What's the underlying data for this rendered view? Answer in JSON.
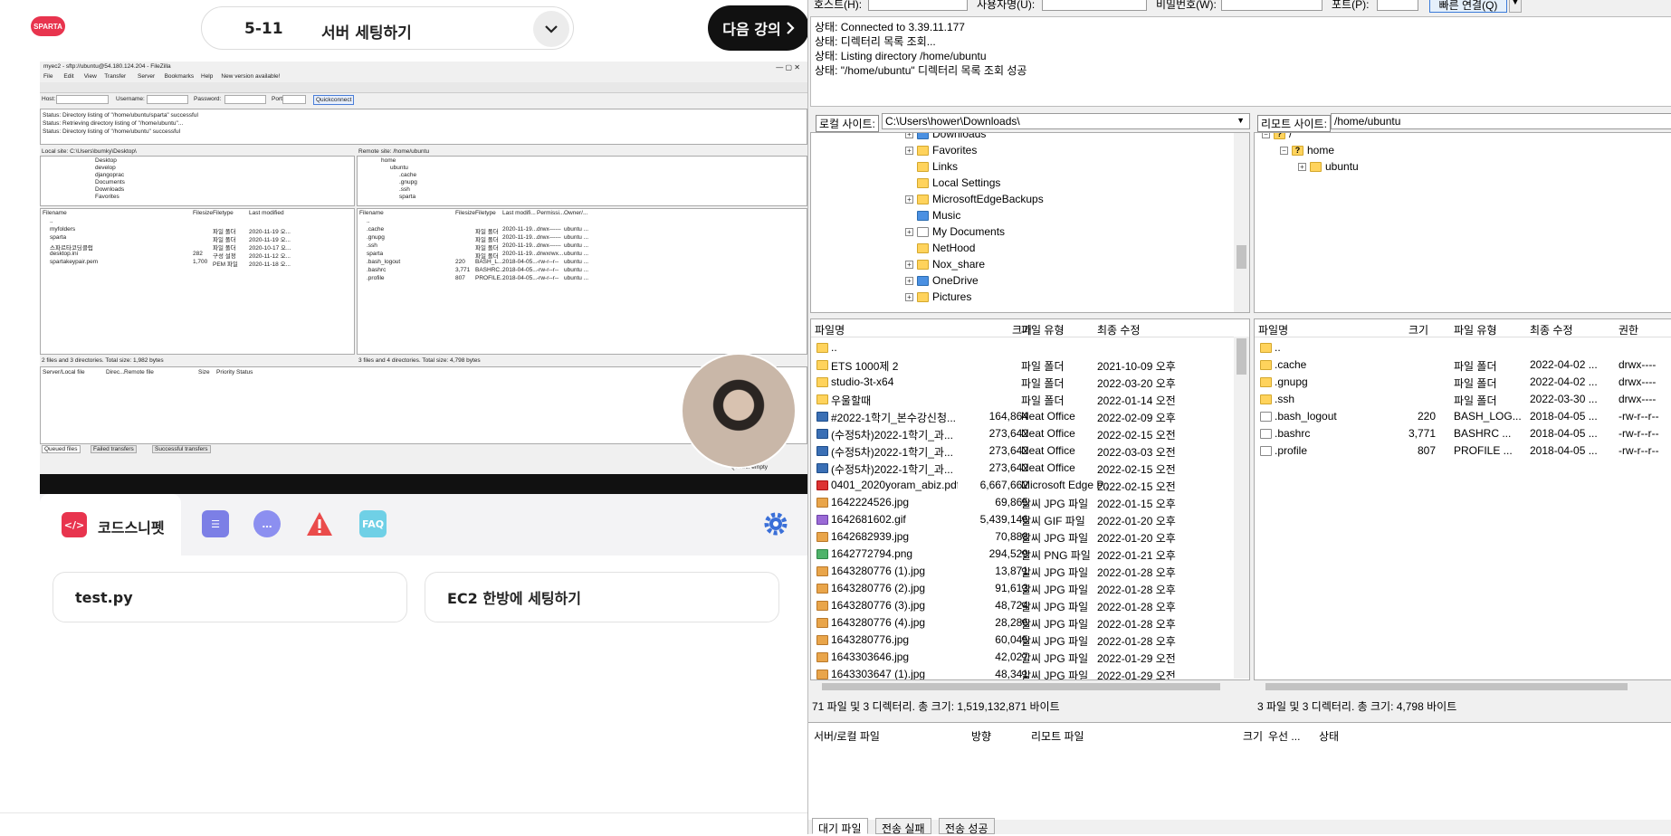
{
  "course": {
    "logo_text": "SPARTA",
    "lecture_number": "5-11",
    "lecture_title": "서버 세팅하기",
    "next_label": "다음 강의",
    "toolbar": {
      "snippet_label": "코드스니펫",
      "faq_label": "FAQ"
    },
    "cards": [
      "test.py",
      "EC2 한방에 세팅하기"
    ]
  },
  "video_filezilla": {
    "title": "myec2 - sftp://ubuntu@54.180.124.204 - FileZilla",
    "menu": [
      "File",
      "Edit",
      "View",
      "Transfer",
      "Server",
      "Bookmarks",
      "Help",
      "New version available!"
    ],
    "quick": {
      "host": "Host:",
      "username": "Username:",
      "password": "Password:",
      "port": "Port:",
      "button": "Quickconnect"
    },
    "log": [
      "Status:    Directory listing of \"/home/ubuntu/sparta\" successful",
      "Status:    Retrieving directory listing of \"/home/ubuntu\"...",
      "Status:    Directory listing of \"/home/ubuntu\" successful"
    ],
    "local_site_label": "Local site:",
    "local_site_path": "C:\\Users\\bumky\\Desktop\\",
    "remote_site_label": "Remote site:",
    "remote_site_path": "/home/ubuntu",
    "local_tree": [
      "Desktop",
      "develop",
      "djangoprac",
      "Documents",
      "Downloads",
      "Favorites"
    ],
    "remote_tree": [
      "home",
      "ubuntu",
      ".cache",
      ".gnupg",
      ".ssh",
      "sparta"
    ],
    "local_headers": [
      "Filename",
      "Filesize",
      "Filetype",
      "Last modified"
    ],
    "local_files": [
      {
        "name": "..",
        "size": "",
        "type": "",
        "date": ""
      },
      {
        "name": "myfolders",
        "size": "",
        "type": "파일 폴더",
        "date": "2020-11-19 오..."
      },
      {
        "name": "sparta",
        "size": "",
        "type": "파일 폴더",
        "date": "2020-11-19 오..."
      },
      {
        "name": "스파르타코딩클럽",
        "size": "",
        "type": "파일 폴더",
        "date": "2020-10-17 오..."
      },
      {
        "name": "desktop.ini",
        "size": "282",
        "type": "구성 설정",
        "date": "2020-11-12 오..."
      },
      {
        "name": "spartakeypair.pem",
        "size": "1,700",
        "type": "PEM 파일",
        "date": "2020-11-18 오..."
      }
    ],
    "remote_headers": [
      "Filename",
      "Filesize",
      "Filetype",
      "Last modifi...",
      "Permissi...",
      "Owner/..."
    ],
    "remote_files": [
      {
        "name": "..",
        "size": "",
        "type": "",
        "date": "",
        "perm": "",
        "owner": ""
      },
      {
        "name": ".cache",
        "size": "",
        "type": "파일 폴더",
        "date": "2020-11-19...",
        "perm": "drwx------",
        "owner": "ubuntu ..."
      },
      {
        "name": ".gnupg",
        "size": "",
        "type": "파일 폴더",
        "date": "2020-11-19...",
        "perm": "drwx------",
        "owner": "ubuntu ..."
      },
      {
        "name": ".ssh",
        "size": "",
        "type": "파일 폴더",
        "date": "2020-11-19...",
        "perm": "drwx------",
        "owner": "ubuntu ..."
      },
      {
        "name": "sparta",
        "size": "",
        "type": "파일 폴더",
        "date": "2020-11-19...",
        "perm": "drwxrwx...",
        "owner": "ubuntu ..."
      },
      {
        "name": ".bash_logout",
        "size": "220",
        "type": "BASH_L...",
        "date": "2018-04-05...",
        "perm": "-rw-r--r--",
        "owner": "ubuntu ..."
      },
      {
        "name": ".bashrc",
        "size": "3,771",
        "type": "BASHRC...",
        "date": "2018-04-05...",
        "perm": "-rw-r--r--",
        "owner": "ubuntu ..."
      },
      {
        "name": ".profile",
        "size": "807",
        "type": "PROFILE...",
        "date": "2018-04-05...",
        "perm": "-rw-r--r--",
        "owner": "ubuntu ..."
      }
    ],
    "local_status": "2 files and 3 directories. Total size: 1,982 bytes",
    "remote_status": "3 files and 4 directories. Total size: 4,798 bytes",
    "queue_headers": [
      "Server/Local file",
      "Direc...",
      "Remote file",
      "Size",
      "Priority",
      "Status"
    ],
    "queue_tabs": [
      "Queued files",
      "Failed transfers",
      "Successful transfers"
    ],
    "queue_status": "Queue: empty"
  },
  "filezilla": {
    "quick": {
      "host_label": "호스트(H):",
      "user_label": "사용자명(U):",
      "pass_label": "비밀번호(W):",
      "port_label": "포트(P):",
      "connect_label": "빠른 연결(Q)"
    },
    "log": [
      "상태: Connected to 3.39.11.177",
      "상태: 디렉터리 목록 조회...",
      "상태: Listing directory /home/ubuntu",
      "상태: \"/home/ubuntu\" 디렉터리 목록 조회 성공"
    ],
    "local_site_label": "로컬 사이트:",
    "local_site_path": "C:\\Users\\hower\\Downloads\\",
    "remote_site_label": "리모트 사이트:",
    "remote_site_path": "/home/ubuntu",
    "local_tree": [
      {
        "name": "Downloads",
        "icon": "download-folder"
      },
      {
        "name": "Favorites",
        "icon": "star-folder"
      },
      {
        "name": "Links",
        "icon": "folder"
      },
      {
        "name": "Local Settings",
        "icon": "folder"
      },
      {
        "name": "MicrosoftEdgeBackups",
        "icon": "folder"
      },
      {
        "name": "Music",
        "icon": "music-folder"
      },
      {
        "name": "My Documents",
        "icon": "doc-folder"
      },
      {
        "name": "NetHood",
        "icon": "folder"
      },
      {
        "name": "Nox_share",
        "icon": "folder"
      },
      {
        "name": "OneDrive",
        "icon": "cloud-folder"
      },
      {
        "name": "Pictures",
        "icon": "picture-folder"
      }
    ],
    "remote_tree": [
      "/",
      "home",
      "ubuntu"
    ],
    "local_headers": [
      "파일명",
      "크기",
      "파일 유형",
      "최종 수정"
    ],
    "local_files": [
      {
        "name": "..",
        "size": "",
        "type": "",
        "date": "",
        "icon": "folder"
      },
      {
        "name": "ETS 1000제 2",
        "size": "",
        "type": "파일 폴더",
        "date": "2021-10-09 오후",
        "icon": "folder"
      },
      {
        "name": "studio-3t-x64",
        "size": "",
        "type": "파일 폴더",
        "date": "2022-03-20 오후",
        "icon": "folder"
      },
      {
        "name": "우울할때",
        "size": "",
        "type": "파일 폴더",
        "date": "2022-01-14 오전",
        "icon": "folder"
      },
      {
        "name": "#2022-1학기_본수강신청...",
        "size": "164,864",
        "type": "Neat Office",
        "date": "2022-02-09 오후",
        "icon": "neat"
      },
      {
        "name": "(수정5차)2022-1학기_과...",
        "size": "273,642",
        "type": "Neat Office",
        "date": "2022-02-15 오전",
        "icon": "neat"
      },
      {
        "name": "(수정5차)2022-1학기_과...",
        "size": "273,642",
        "type": "Neat Office",
        "date": "2022-03-03 오전",
        "icon": "neat"
      },
      {
        "name": "(수정5차)2022-1학기_과...",
        "size": "273,642",
        "type": "Neat Office",
        "date": "2022-02-15 오전",
        "icon": "neat"
      },
      {
        "name": "0401_2020yoram_abiz.pdf",
        "size": "6,667,662",
        "type": "Microsoft Edge P...",
        "date": "2022-02-15 오전",
        "icon": "pdf"
      },
      {
        "name": "1642224526.jpg",
        "size": "69,865",
        "type": "알씨 JPG 파일",
        "date": "2022-01-15 오후",
        "icon": "jpg"
      },
      {
        "name": "1642681602.gif",
        "size": "5,439,146",
        "type": "알씨 GIF 파일",
        "date": "2022-01-20 오후",
        "icon": "gif"
      },
      {
        "name": "1642682939.jpg",
        "size": "70,888",
        "type": "알씨 JPG 파일",
        "date": "2022-01-20 오후",
        "icon": "jpg"
      },
      {
        "name": "1642772794.png",
        "size": "294,529",
        "type": "알씨 PNG 파일",
        "date": "2022-01-21 오후",
        "icon": "png"
      },
      {
        "name": "1643280776 (1).jpg",
        "size": "13,871",
        "type": "알씨 JPG 파일",
        "date": "2022-01-28 오후",
        "icon": "jpg"
      },
      {
        "name": "1643280776 (2).jpg",
        "size": "91,613",
        "type": "알씨 JPG 파일",
        "date": "2022-01-28 오후",
        "icon": "jpg"
      },
      {
        "name": "1643280776 (3).jpg",
        "size": "48,724",
        "type": "알씨 JPG 파일",
        "date": "2022-01-28 오후",
        "icon": "jpg"
      },
      {
        "name": "1643280776 (4).jpg",
        "size": "28,286",
        "type": "알씨 JPG 파일",
        "date": "2022-01-28 오후",
        "icon": "jpg"
      },
      {
        "name": "1643280776.jpg",
        "size": "60,045",
        "type": "알씨 JPG 파일",
        "date": "2022-01-28 오후",
        "icon": "jpg"
      },
      {
        "name": "1643303646.jpg",
        "size": "42,027",
        "type": "알씨 JPG 파일",
        "date": "2022-01-29 오전",
        "icon": "jpg"
      },
      {
        "name": "1643303647 (1).jpg",
        "size": "48,341",
        "type": "알씨 JPG 파일",
        "date": "2022-01-29 오전",
        "icon": "jpg"
      }
    ],
    "remote_headers": [
      "파일명",
      "크기",
      "파일 유형",
      "최종 수정",
      "권한"
    ],
    "remote_files": [
      {
        "name": "..",
        "size": "",
        "type": "",
        "date": "",
        "perm": "",
        "icon": "folder"
      },
      {
        "name": ".cache",
        "size": "",
        "type": "파일 폴더",
        "date": "2022-04-02 ...",
        "perm": "drwx----",
        "icon": "folder"
      },
      {
        "name": ".gnupg",
        "size": "",
        "type": "파일 폴더",
        "date": "2022-04-02 ...",
        "perm": "drwx----",
        "icon": "folder"
      },
      {
        "name": ".ssh",
        "size": "",
        "type": "파일 폴더",
        "date": "2022-03-30 ...",
        "perm": "drwx----",
        "icon": "folder"
      },
      {
        "name": ".bash_logout",
        "size": "220",
        "type": "BASH_LOG...",
        "date": "2018-04-05 ...",
        "perm": "-rw-r--r--",
        "icon": "doc"
      },
      {
        "name": ".bashrc",
        "size": "3,771",
        "type": "BASHRC ...",
        "date": "2018-04-05 ...",
        "perm": "-rw-r--r--",
        "icon": "doc"
      },
      {
        "name": ".profile",
        "size": "807",
        "type": "PROFILE ...",
        "date": "2018-04-05 ...",
        "perm": "-rw-r--r--",
        "icon": "doc"
      }
    ],
    "local_status": "71 파일 및 3 디렉터리. 총 크기: 1,519,132,871 바이트",
    "remote_status": "3 파일 및 3 디렉터리. 총 크기: 4,798 바이트",
    "queue_headers": [
      "서버/로컬 파일",
      "방향",
      "리모트 파일",
      "크기",
      "우선 ...",
      "상태"
    ],
    "queue_tabs": [
      "대기 파일",
      "전송 실패",
      "전송 성공"
    ]
  }
}
